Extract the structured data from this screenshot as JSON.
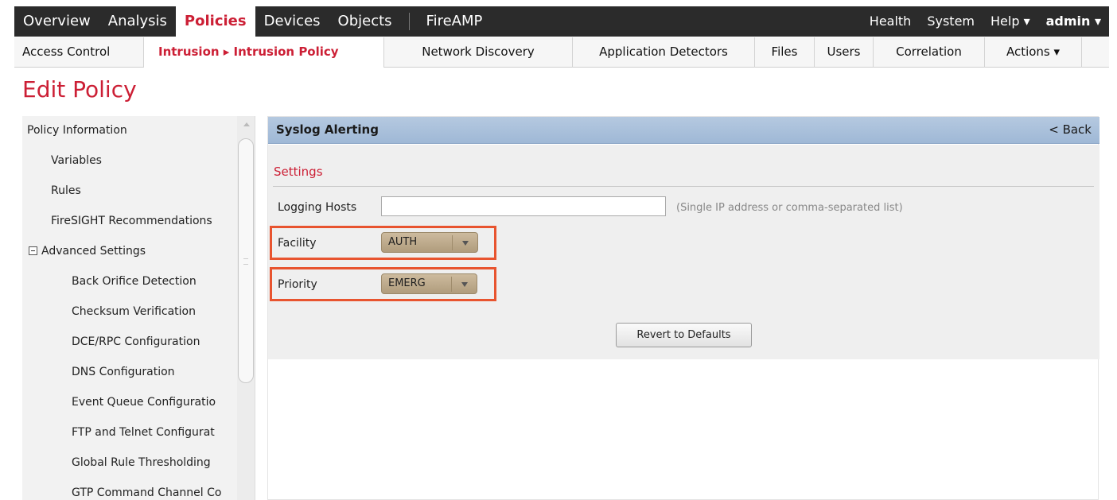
{
  "topnav": {
    "items": [
      "Overview",
      "Analysis",
      "Policies",
      "Devices",
      "Objects"
    ],
    "fireamp": "FireAMP",
    "right": {
      "health": "Health",
      "system": "System",
      "help": "Help ▾",
      "admin": "admin ▾"
    }
  },
  "subnav": {
    "access_control": "Access Control",
    "intrusion": "Intrusion ▸ Intrusion Policy",
    "network_discovery": "Network Discovery",
    "application_detectors": "Application Detectors",
    "files": "Files",
    "users": "Users",
    "correlation": "Correlation",
    "actions": "Actions ▾"
  },
  "page": {
    "title": "Edit Policy"
  },
  "sidebar": {
    "policy_information": "Policy Information",
    "variables": "Variables",
    "rules": "Rules",
    "firesight": "FireSIGHT Recommendations",
    "advanced_settings": "Advanced Settings",
    "advanced_items": [
      "Back Orifice Detection",
      "Checksum Verification",
      "DCE/RPC Configuration",
      "DNS Configuration",
      "Event Queue Configuratio",
      "FTP and Telnet Configurat",
      "Global Rule Thresholding",
      "GTP Command Channel Co"
    ]
  },
  "panel": {
    "title": "Syslog Alerting",
    "back": "< Back",
    "settings_heading": "Settings",
    "logging_hosts_label": "Logging Hosts",
    "logging_hosts_value": "",
    "logging_hosts_hint": "(Single IP address or comma-separated list)",
    "facility_label": "Facility",
    "facility_value": "AUTH",
    "priority_label": "Priority",
    "priority_value": "EMERG",
    "revert_button": "Revert to Defaults"
  },
  "colors": {
    "accent_red": "#cc1f35",
    "nav_dark": "#2b2b2b",
    "panel_header_blue": "#a9c0dc",
    "highlight_orange": "#e8542f",
    "select_tan": "#bfa98a"
  }
}
